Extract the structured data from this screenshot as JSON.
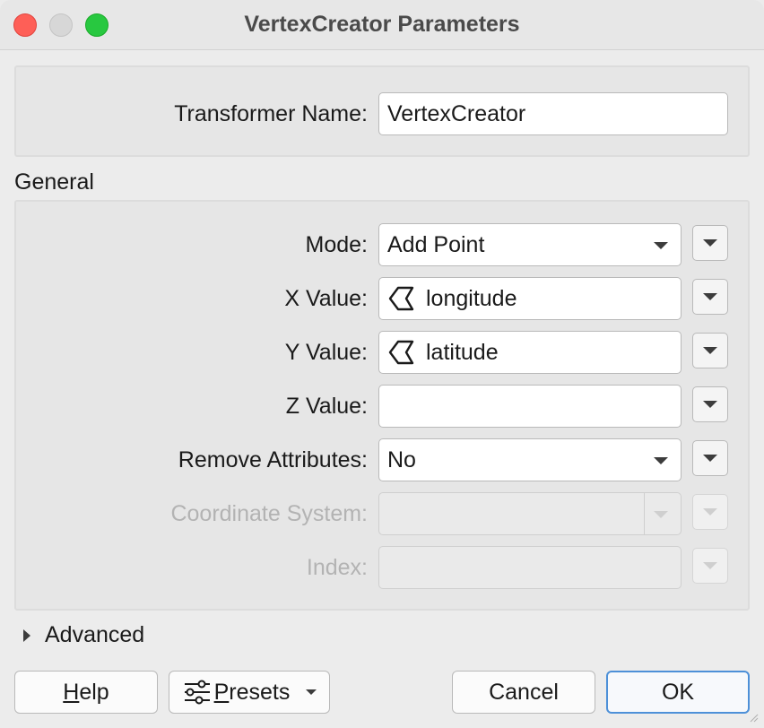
{
  "window": {
    "title": "VertexCreator Parameters"
  },
  "transformer": {
    "name_label": "Transformer Name:",
    "name_value": "VertexCreator"
  },
  "general": {
    "section_label": "General",
    "rows": [
      {
        "label": "Mode:",
        "value": "Add Point",
        "kind": "dropdown",
        "enabled": true
      },
      {
        "label": "X Value:",
        "value": "longitude",
        "kind": "attribute",
        "enabled": true
      },
      {
        "label": "Y Value:",
        "value": "latitude",
        "kind": "attribute",
        "enabled": true
      },
      {
        "label": "Z Value:",
        "value": "",
        "kind": "text",
        "enabled": true
      },
      {
        "label": "Remove Attributes:",
        "value": "No",
        "kind": "dropdown",
        "enabled": true
      },
      {
        "label": "Coordinate System:",
        "value": "",
        "kind": "dropdown",
        "enabled": false
      },
      {
        "label": "Index:",
        "value": "",
        "kind": "text",
        "enabled": false
      }
    ]
  },
  "advanced": {
    "label": "Advanced",
    "icon": "disclosure-triangle-right-icon"
  },
  "buttons": {
    "help": "Help",
    "presets": "Presets",
    "cancel": "Cancel",
    "ok": "OK"
  },
  "colors": {
    "close": "#fe5f57",
    "minimize": "#d7d7d7",
    "maximize": "#28c840",
    "ok_border": "#4d90d8",
    "disabled_text": "#b3b3b3"
  }
}
